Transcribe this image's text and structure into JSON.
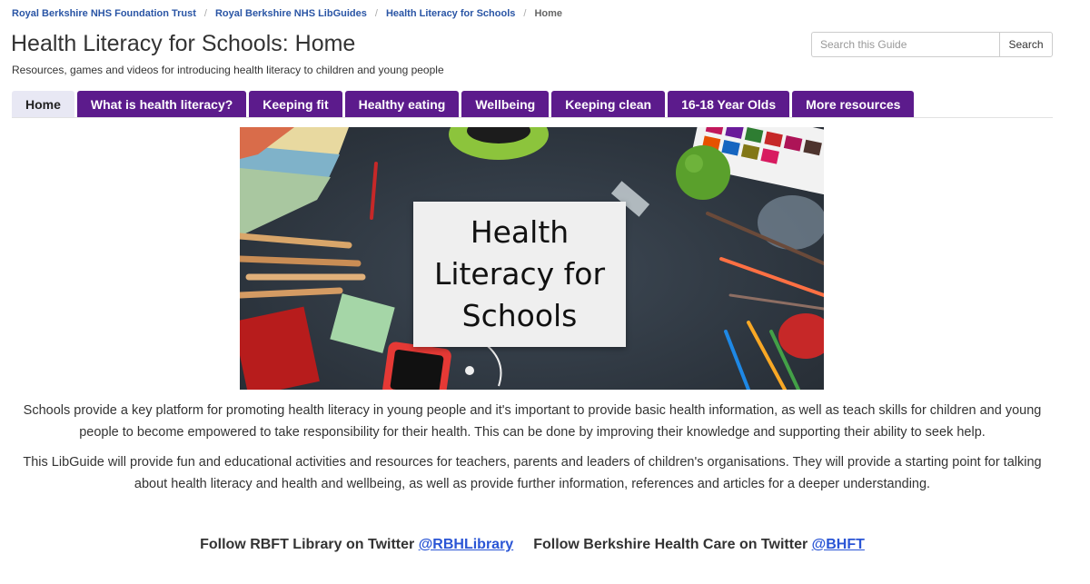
{
  "breadcrumb": {
    "items": [
      "Royal Berkshire NHS Foundation Trust",
      "Royal Berkshire NHS LibGuides",
      "Health Literacy for Schools"
    ],
    "current": "Home"
  },
  "header": {
    "title": "Health Literacy for Schools: Home",
    "subtitle": "Resources, games and videos for introducing health literacy to children and young people"
  },
  "search": {
    "placeholder": "Search this Guide",
    "button_label": "Search"
  },
  "tabs": [
    {
      "label": "Home",
      "active": true
    },
    {
      "label": "What is health literacy?",
      "active": false
    },
    {
      "label": "Keeping fit",
      "active": false
    },
    {
      "label": "Healthy eating",
      "active": false
    },
    {
      "label": "Wellbeing",
      "active": false
    },
    {
      "label": "Keeping clean",
      "active": false
    },
    {
      "label": "16-18 Year Olds",
      "active": false
    },
    {
      "label": "More resources",
      "active": false
    }
  ],
  "hero": {
    "card_text": "Health\nLiteracy for\nSchools"
  },
  "content": {
    "paragraph1": "Schools provide a key platform for promoting health literacy in young people and it's important to provide basic health information, as well as teach skills for children and young people to become empowered to take responsibility for their health. This can be done by improving their knowledge and supporting their ability to seek help.",
    "paragraph2": "This LibGuide will provide fun and educational activities and resources for teachers, parents and leaders of children's organisations. They will provide a starting point for talking about health literacy and health and wellbeing, as well as provide further information, references and articles for a deeper understanding."
  },
  "follow": {
    "library_text": "Follow RBFT Library on Twitter",
    "library_handle": "@RBHLibrary",
    "bhft_text": "Follow Berkshire Health Care on Twitter",
    "bhft_handle": "@BHFT"
  },
  "colors": {
    "tab_background": "#5c1b8c",
    "tab_active_background": "#e8e8f4",
    "link": "#2a55a5"
  }
}
